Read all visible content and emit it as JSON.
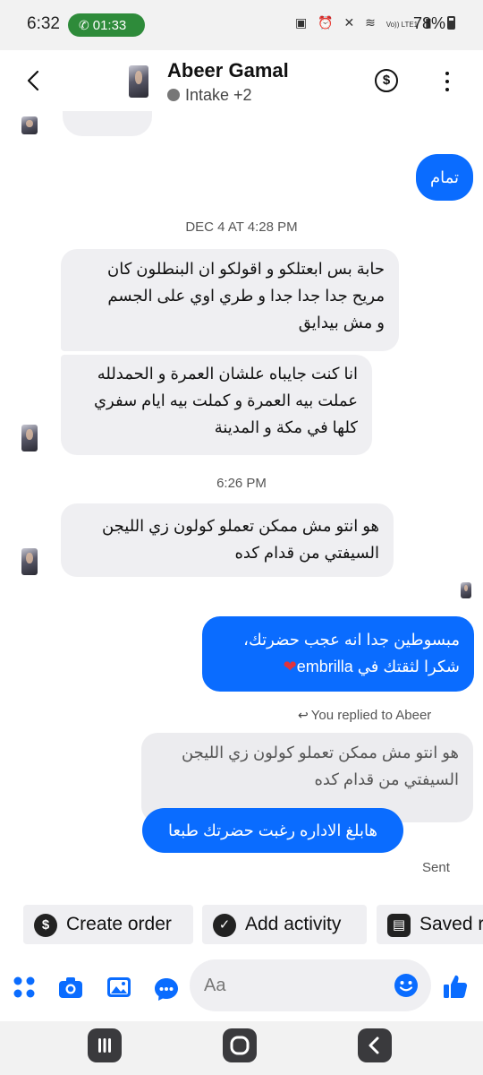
{
  "status_bar": {
    "time": "6:32",
    "call_timer": "01:33",
    "battery": "78%",
    "network_label": "Vo)) LTE1"
  },
  "header": {
    "contact_name": "Abeer Gamal",
    "subtitle": "Intake +2"
  },
  "messages": {
    "partial_top": "",
    "out_1": "تمام",
    "timestamp_1": "DEC 4 AT 4:28 PM",
    "in_1": [
      "حابة بس ابعتلكو و اقولكو ان البنطلون كان",
      "مريح جدا جدا جدا و طري اوي على الجسم",
      "و مش بيدايق"
    ],
    "in_2": [
      "انا كنت جايباه علشان العمرة و الحمدلله",
      "عملت بيه العمرة و كملت بيه ايام سفري",
      "كلها في مكة و المدينة"
    ],
    "timestamp_2": "6:26 PM",
    "in_3": [
      "هو انتو مش ممكن تعملو كولون زي الليجن",
      "السيفتي من قدام كده"
    ],
    "out_2": [
      "مبسوطين جدا انه عجب حضرتك،",
      "شكرا لثقتك في embrilla"
    ],
    "replied_label": "You replied to Abeer",
    "quoted": [
      "هو انتو مش ممكن تعملو كولون زي الليجن",
      "السيفتي من قدام كده"
    ],
    "out_3": "هابلغ الاداره رغبت حضرتك طبعا",
    "sent_label": "Sent"
  },
  "chips": {
    "create_order": "Create order",
    "add_activity": "Add activity",
    "saved": "Saved r"
  },
  "composer": {
    "placeholder": "Aa"
  },
  "colors": {
    "accent": "#0a6cff",
    "incoming_bubble": "#efeff2",
    "call_green": "#2e8b3a"
  },
  "icons": [
    "back-arrow-icon",
    "dollar-icon",
    "more-vertical-icon",
    "phone-icon",
    "apps-grid-icon",
    "camera-icon",
    "gallery-icon",
    "chat-bubble-icon",
    "emoji-icon",
    "thumbs-up-icon",
    "recents-icon",
    "home-icon",
    "back-nav-icon",
    "heart-icon",
    "check-icon",
    "saved-replies-icon",
    "reply-arrow-icon"
  ]
}
